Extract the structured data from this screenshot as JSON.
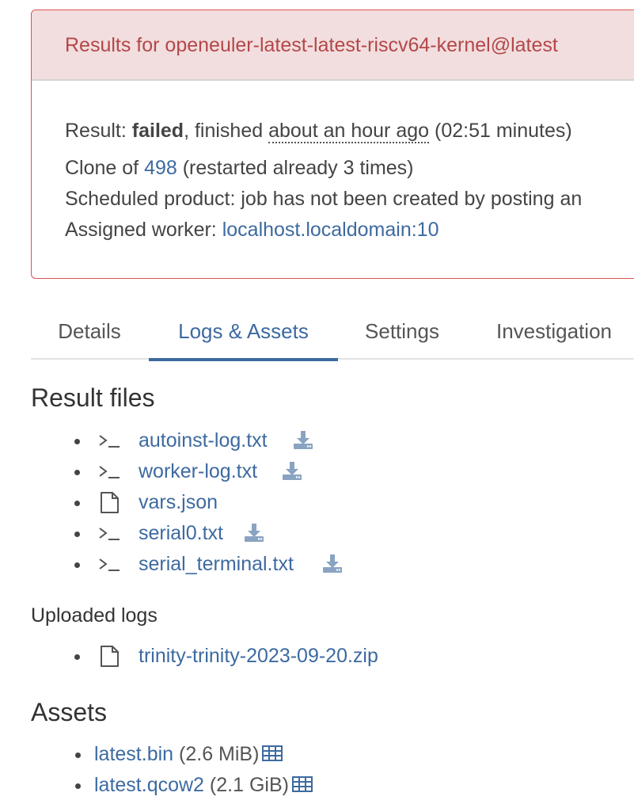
{
  "result_card": {
    "title": "Results for openeuler-latest-latest-riscv64-kernel@latest",
    "result_label": "Result: ",
    "result_value": "failed",
    "finished_text": ", finished ",
    "finished_time": "about an hour ago",
    "duration": " (02:51 minutes)",
    "clone_label": "Clone of ",
    "clone_id": "498",
    "clone_suffix": " (restarted already 3 times)",
    "scheduled_text": "Scheduled product: job has not been created by posting an",
    "worker_label": "Assigned worker: ",
    "worker_value": "localhost.localdomain:10"
  },
  "tabs": [
    "Details",
    "Logs & Assets",
    "Settings",
    "Investigation"
  ],
  "active_tab": "Logs & Assets",
  "result_files": {
    "heading": "Result files",
    "items": [
      {
        "icon": "terminal-icon",
        "name": "autoinst-log.txt",
        "download": true
      },
      {
        "icon": "terminal-icon",
        "name": "worker-log.txt",
        "download": true
      },
      {
        "icon": "file-icon",
        "name": "vars.json",
        "download": false
      },
      {
        "icon": "terminal-icon",
        "name": "serial0.txt",
        "download": true
      },
      {
        "icon": "terminal-icon",
        "name": "serial_terminal.txt",
        "download": true
      }
    ]
  },
  "uploaded_logs": {
    "heading": "Uploaded logs",
    "items": [
      {
        "icon": "file-icon",
        "name": "trinity-trinity-2023-09-20.zip"
      }
    ]
  },
  "assets": {
    "heading": "Assets",
    "items": [
      {
        "name": "latest.bin",
        "size": "(2.6 MiB)",
        "icon": "table-icon"
      },
      {
        "name": "latest.qcow2",
        "size": "(2.1 GiB)",
        "icon": "table-icon"
      }
    ]
  },
  "colors": {
    "link": "#3d6aa0",
    "danger_border": "#d9534f",
    "danger_bg": "#f2dede",
    "danger_text": "#b4474a",
    "download_icon": "#8aa3c2"
  }
}
